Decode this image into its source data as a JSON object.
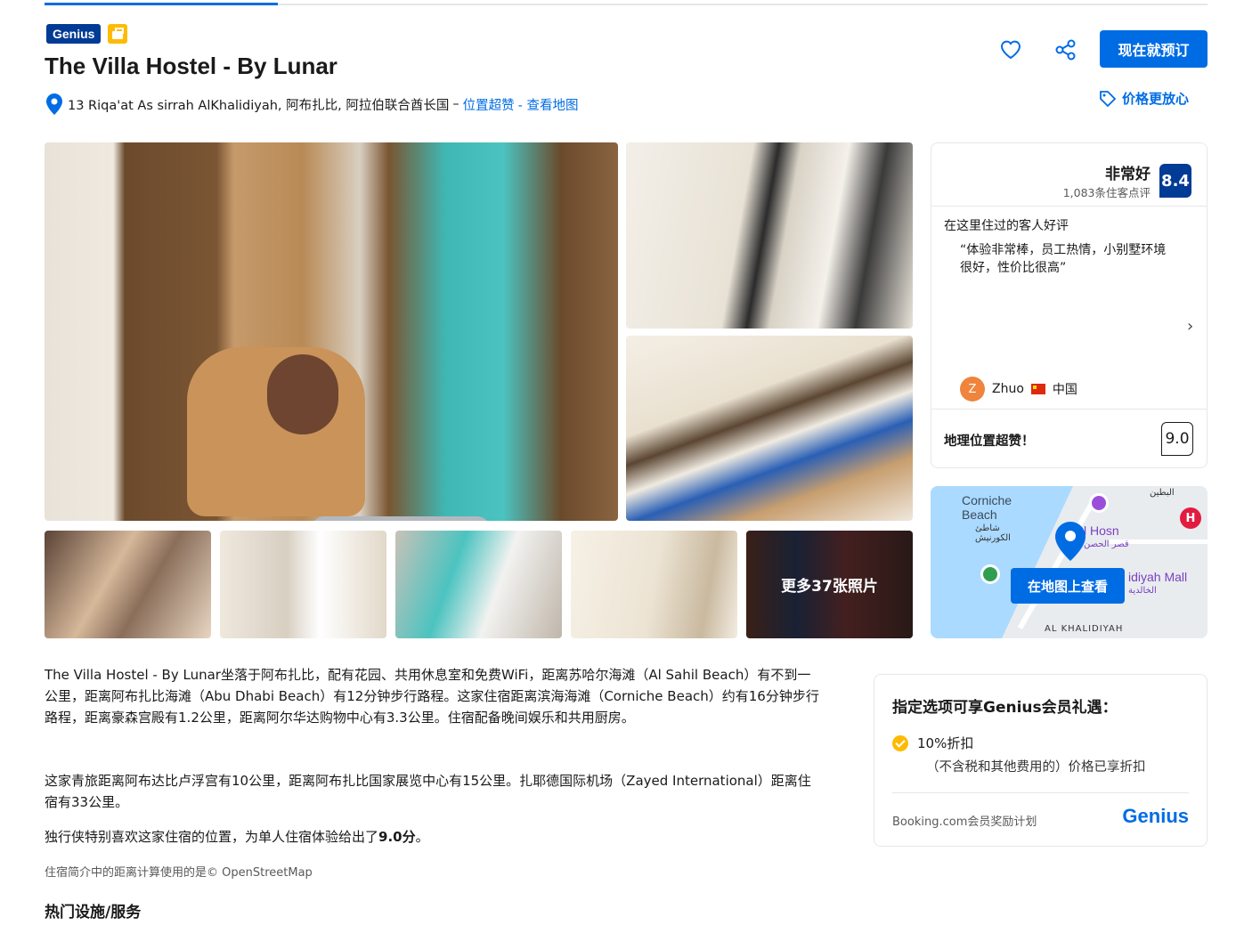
{
  "header": {
    "genius_badge": "Genius",
    "title": "The Villa Hostel - By Lunar",
    "address": "13 Riqa'at As sirrah AlKhalidiyah, 阿布扎比, 阿拉伯联合酋长国",
    "address_dash": "–",
    "location_link": "位置超赞",
    "map_link": "- 查看地图",
    "book_button": "现在就预订",
    "price_promise": "价格更放心"
  },
  "gallery": {
    "more_photos": "更多37张照片"
  },
  "review": {
    "score_label": "非常好",
    "review_count": "1,083条住客点评",
    "score": "8.4",
    "guests_liked": "在这里住过的客人好评",
    "quote": "“体验非常棒，员工热情，小别墅环境很好，性价比很高”",
    "chevron": "›",
    "reviewer_initial": "Z",
    "reviewer_name": "Zhuo",
    "reviewer_country": "中国",
    "location_label": "地理位置超赞！",
    "location_score": "9.0"
  },
  "map": {
    "label_corniche": "Corniche Beach",
    "label_corniche_ar": "شاطئ الكورنيش",
    "label_hosn": "l Hosn",
    "label_hosn_ar": "قصر الحصن",
    "label_mall": "idiyah Mall",
    "label_mall_ar": "الخالدية",
    "label_district": "AL KHALIDIYAH",
    "label_top_ar": "البطين",
    "button": "在地图上查看",
    "hospital": "H"
  },
  "description": {
    "p1": "The Villa Hostel - By Lunar坐落于阿布扎比，配有花园、共用休息室和免费WiFi，距离苏哈尔海滩（Al Sahil Beach）有不到一公里，距离阿布扎比海滩（Abu Dhabi Beach）有12分钟步行路程。这家住宿距离滨海海滩（Corniche Beach）约有16分钟步行路程，距离豪森宫殿有1.2公里，距离阿尔华达购物中心有3.3公里。住宿配备晚间娱乐和共用厨房。",
    "p2": "这家青旅距离阿布达比卢浮宫有10公里，距离阿布扎比国家展览中心有15公里。扎耶德国际机场（Zayed International）距离住宿有33公里。",
    "p3_prefix": "独行侠特别喜欢这家住宿的位置，为单人住宿体验给出了",
    "p3_score": "9.0分",
    "p3_suffix": "。",
    "osm_note": "住宿简介中的距离计算使用的是© OpenStreetMap",
    "facilities_title": "热门设施/服务"
  },
  "genius": {
    "title": "指定选项可享Genius会员礼遇：",
    "discount": "10%折扣",
    "discount_sub": "（不含税和其他费用的）价格已享折扣",
    "footer": "Booking.com会员奖励计划",
    "logo": "Genius"
  },
  "colors": {
    "primary": "#006ce4",
    "dark_blue": "#003b95",
    "genius_yellow": "#febb02"
  }
}
